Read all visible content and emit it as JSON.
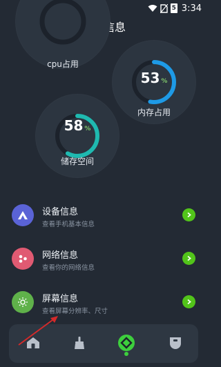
{
  "status_bar": {
    "time": "3:34",
    "battery": "5"
  },
  "page_title": "基本信息",
  "gauges": {
    "cpu": {
      "label": "cpu占用"
    },
    "memory": {
      "label": "内存占用",
      "percent": 53,
      "percent_text": "53",
      "percent_symbol": "%",
      "color": "#1e9ae6"
    },
    "storage": {
      "label": "储存空间",
      "percent": 58,
      "percent_text": "58",
      "percent_symbol": "%",
      "color": "#1fb9b0"
    }
  },
  "info_rows": [
    {
      "title": "设备信息",
      "subtitle": "查看手机基本信息",
      "icon": "device-icon",
      "color": "#5a63d6"
    },
    {
      "title": "网络信息",
      "subtitle": "查看你的网络信息",
      "icon": "network-icon",
      "color": "#e05a72"
    },
    {
      "title": "屏幕信息",
      "subtitle": "查看屏幕分辨率、尺寸",
      "icon": "screen-icon",
      "color": "#5fb14a"
    }
  ],
  "bottom_nav": {
    "items": [
      {
        "icon": "home-icon"
      },
      {
        "icon": "broom-icon"
      },
      {
        "icon": "info-icon",
        "active": true
      },
      {
        "icon": "toolbox-icon"
      }
    ]
  },
  "accent": "#52c41a"
}
